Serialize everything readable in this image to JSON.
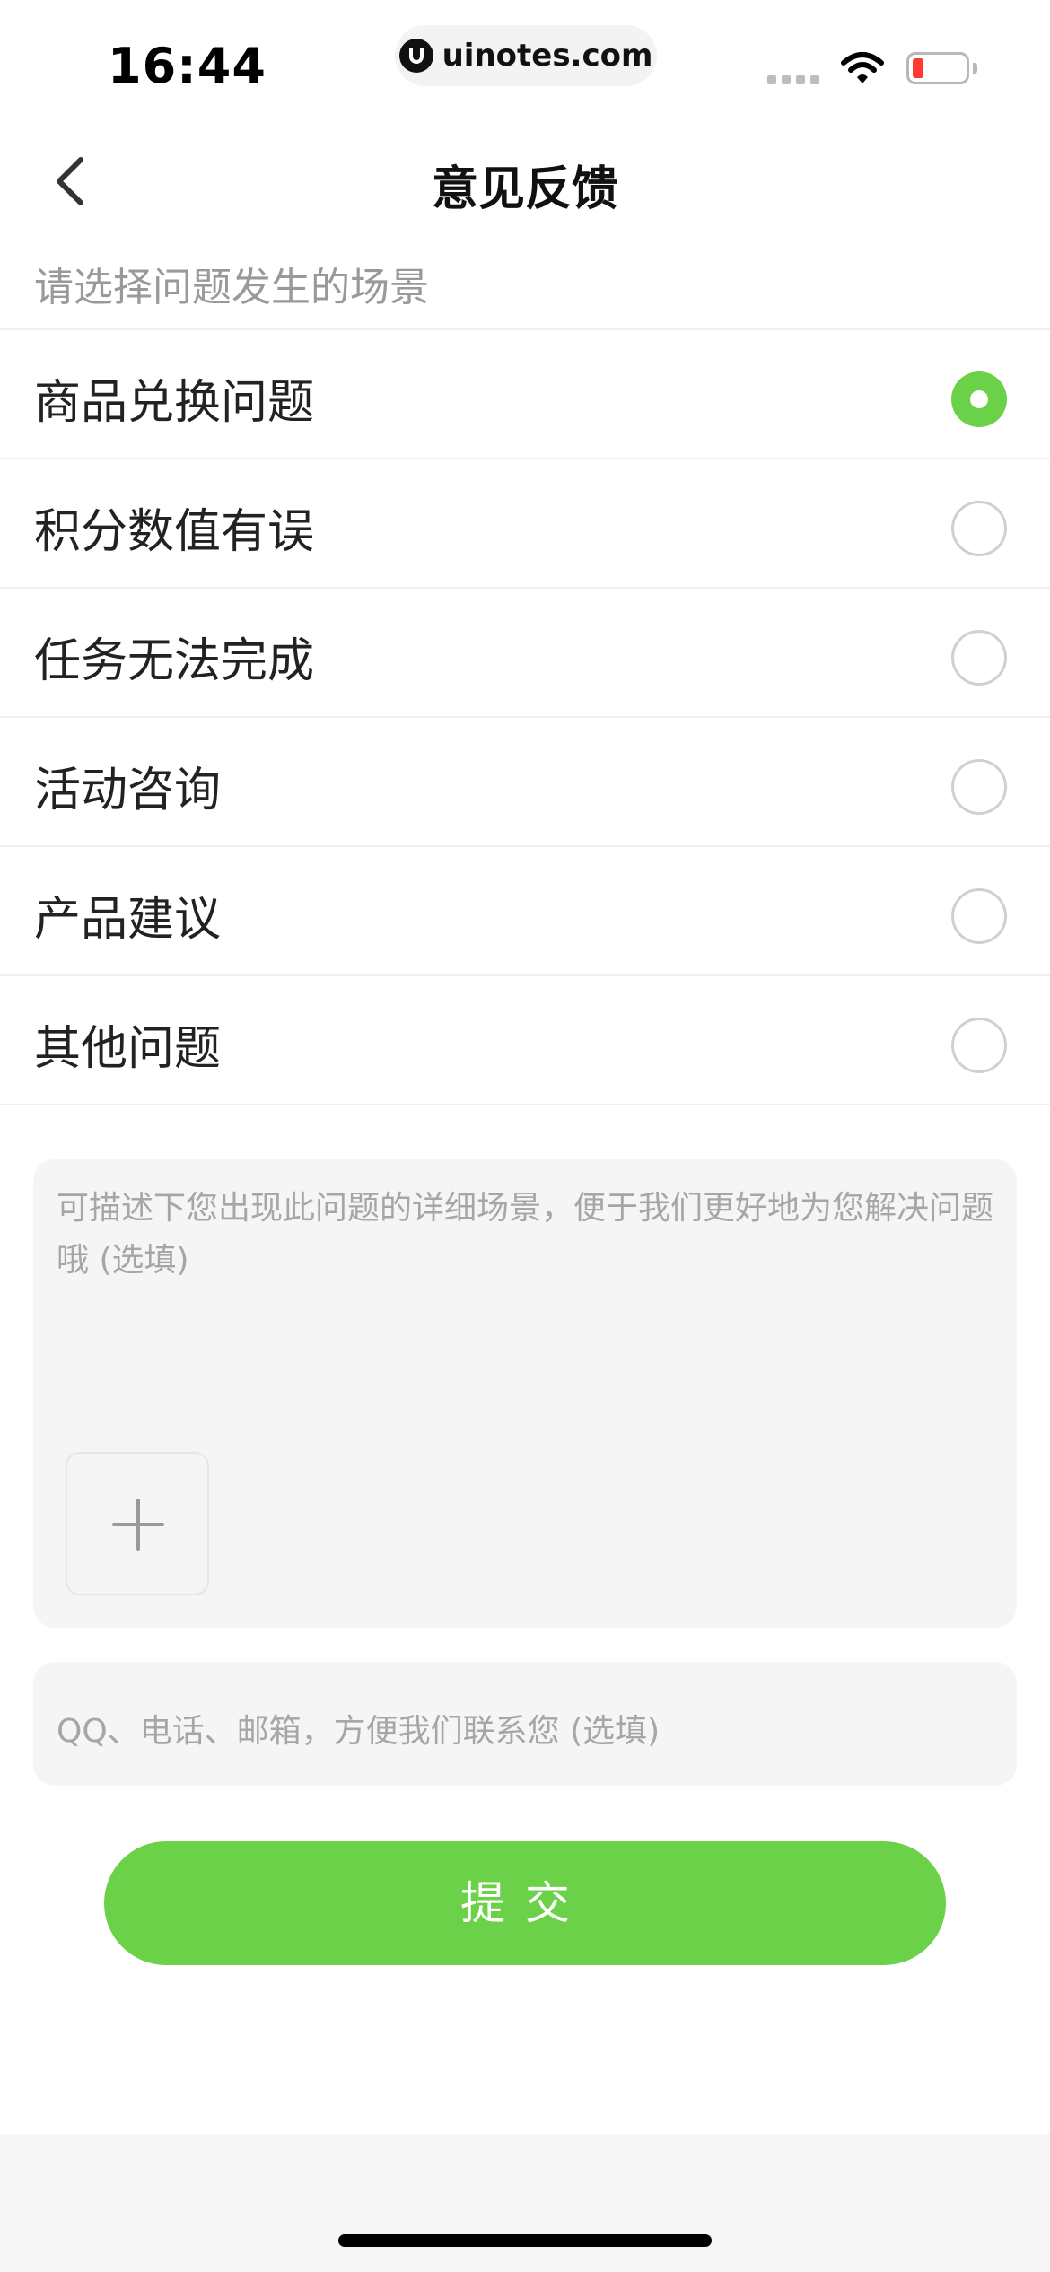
{
  "status_bar": {
    "time": "16:44",
    "url": "uinotes.com",
    "icons": [
      "cellular-signal-icon",
      "wifi-icon",
      "battery-low-icon"
    ],
    "colors": {
      "battery_low": "#ff3b30"
    }
  },
  "header": {
    "back_icon": "chevron-left-icon",
    "title": "意见反馈"
  },
  "scene_hint": "请选择问题发生的场景",
  "options": [
    {
      "label": "商品兑换问题",
      "selected": true
    },
    {
      "label": "积分数值有误",
      "selected": false
    },
    {
      "label": "任务无法完成",
      "selected": false
    },
    {
      "label": "活动咨询",
      "selected": false
    },
    {
      "label": "产品建议",
      "selected": false
    },
    {
      "label": "其他问题",
      "selected": false
    }
  ],
  "detail": {
    "placeholder": "可描述下您出现此问题的详细场景，便于我们更好地为您解决问题哦 (选填)",
    "add_icon": "plus-icon"
  },
  "contact": {
    "placeholder": "QQ、电话、邮箱，方便我们联系您 (选填)"
  },
  "submit_label": "提交",
  "colors": {
    "accent": "#6ad148",
    "placeholder_text": "#a6a6a6",
    "field_background": "#f5f5f5"
  }
}
